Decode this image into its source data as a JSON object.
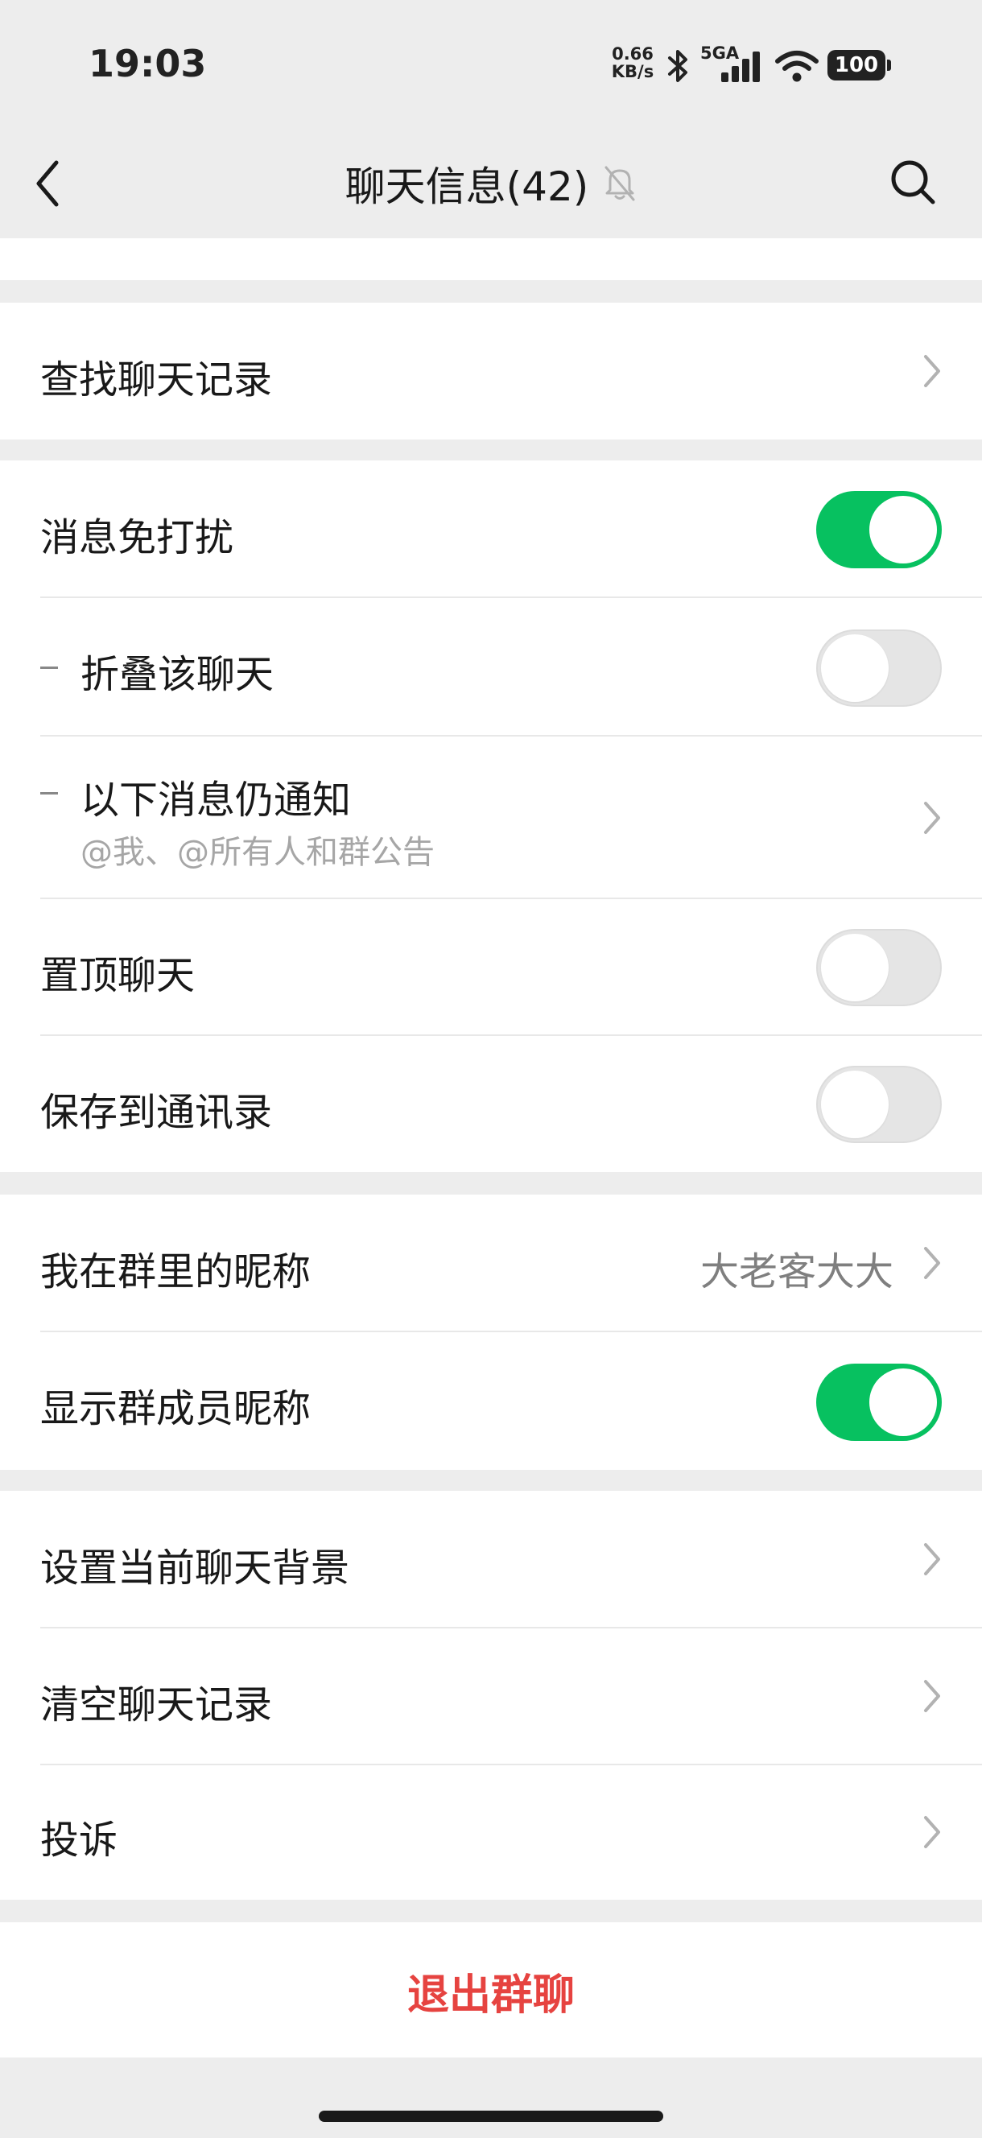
{
  "status_bar": {
    "time": "19:03",
    "net_speed_value": "0.66",
    "net_speed_unit": "KB/s",
    "network_type": "5GA",
    "battery": "100",
    "icons": [
      "bluetooth-icon",
      "signal-icon",
      "wifi-icon",
      "battery-icon"
    ]
  },
  "header": {
    "title": "聊天信息(42)",
    "back_icon": "chevron-left-icon",
    "muted_icon": "bell-off-icon",
    "search_icon": "search-icon"
  },
  "search_history": {
    "label": "查找聊天记录"
  },
  "notifications": {
    "mute": {
      "label": "消息免打扰",
      "toggle": true
    },
    "fold": {
      "label": "折叠该聊天",
      "toggle": false
    },
    "still_notify": {
      "label": "以下消息仍通知",
      "sub": "@我、@所有人和群公告"
    },
    "pin": {
      "label": "置顶聊天",
      "toggle": false
    },
    "save_contacts": {
      "label": "保存到通讯录",
      "toggle": false
    }
  },
  "nickname": {
    "my_nickname": {
      "label": "我在群里的昵称",
      "value": "大老客大大"
    },
    "show_member_names": {
      "label": "显示群成员昵称",
      "toggle": true
    }
  },
  "actions": {
    "background": {
      "label": "设置当前聊天背景"
    },
    "clear": {
      "label": "清空聊天记录"
    },
    "report": {
      "label": "投诉"
    }
  },
  "exit": {
    "label": "退出群聊"
  },
  "colors": {
    "accent_green": "#07c160",
    "danger_red": "#e64340",
    "page_bg": "#ededed"
  }
}
